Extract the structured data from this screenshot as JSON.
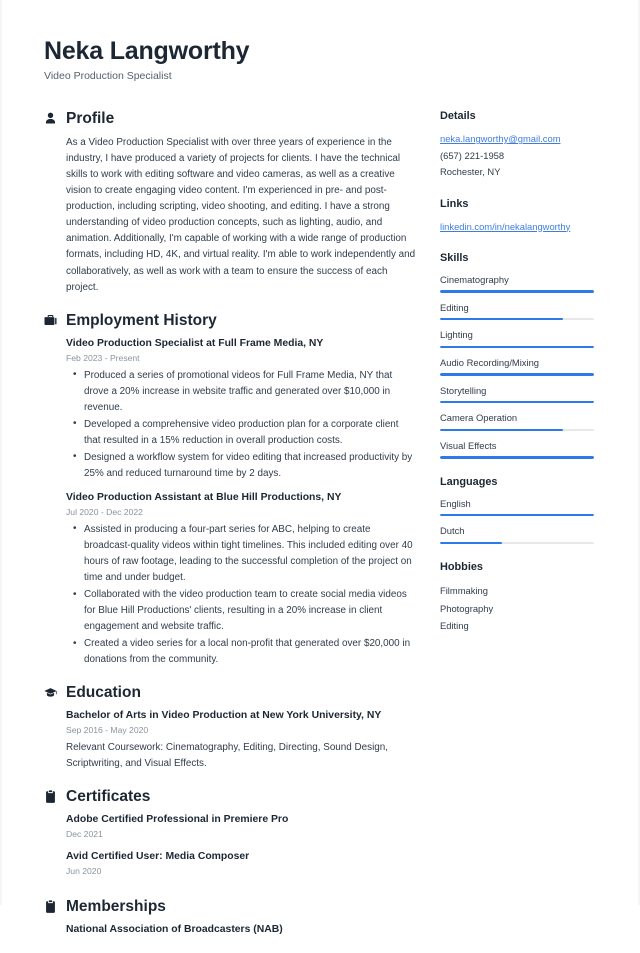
{
  "theme": {
    "accent": "#2f7aea",
    "link": "#3f7ce0",
    "heading": "#1c2733",
    "text": "#313c4b",
    "muted": "#8a939f",
    "track": "#e6e8ea",
    "background": "#ffffff"
  },
  "header": {
    "name": "Neka Langworthy",
    "title": "Video Production Specialist"
  },
  "sections": {
    "profile": {
      "icon": "person-icon",
      "title": "Profile",
      "text": "As a Video Production Specialist with over three years of experience in the industry, I have produced a variety of projects for clients. I have the technical skills to work with editing software and video cameras, as well as a creative vision to create engaging video content. I'm experienced in pre- and post-production, including scripting, video shooting, and editing. I have a strong understanding of video production concepts, such as lighting, audio, and animation. Additionally, I'm capable of working with a wide range of production formats, including HD, 4K, and virtual reality. I'm able to work independently and collaboratively, as well as work with a team to ensure the success of each project."
    },
    "employment": {
      "icon": "briefcase-icon",
      "title": "Employment History",
      "entries": [
        {
          "title": "Video Production Specialist at Full Frame Media, NY",
          "date": "Feb 2023 - Present",
          "bullets": [
            "Produced a series of promotional videos for Full Frame Media, NY that drove a 20% increase in website traffic and generated over $10,000 in revenue.",
            "Developed a comprehensive video production plan for a corporate client that resulted in a 15% reduction in overall production costs.",
            "Designed a workflow system for video editing that increased productivity by 25% and reduced turnaround time by 2 days."
          ]
        },
        {
          "title": "Video Production Assistant at Blue Hill Productions, NY",
          "date": "Jul 2020 - Dec 2022",
          "bullets": [
            "Assisted in producing a four-part series for ABC, helping to create broadcast-quality videos within tight timelines. This included editing over 40 hours of raw footage, leading to the successful completion of the project on time and under budget.",
            "Collaborated with the video production team to create social media videos for Blue Hill Productions' clients, resulting in a 20% increase in client engagement and website traffic.",
            "Created a video series for a local non-profit that generated over $20,000 in donations from the community."
          ]
        }
      ]
    },
    "education": {
      "icon": "graduation-cap-icon",
      "title": "Education",
      "entries": [
        {
          "title": "Bachelor of Arts in Video Production at New York University, NY",
          "date": "Sep 2016 - May 2020",
          "description": "Relevant Coursework: Cinematography, Editing, Directing, Sound Design, Scriptwriting, and Visual Effects."
        }
      ]
    },
    "certificates": {
      "icon": "clipboard-icon",
      "title": "Certificates",
      "entries": [
        {
          "title": "Adobe Certified Professional in Premiere Pro",
          "date": "Dec 2021"
        },
        {
          "title": "Avid Certified User: Media Composer",
          "date": "Jun 2020"
        }
      ]
    },
    "memberships": {
      "icon": "clipboard-icon",
      "title": "Memberships",
      "entries": [
        {
          "title": "National Association of Broadcasters (NAB)"
        }
      ]
    }
  },
  "sidebar": {
    "details": {
      "title": "Details",
      "email": "neka.langworthy@gmail.com",
      "phone": "(657) 221-1958",
      "location": "Rochester, NY"
    },
    "links": {
      "title": "Links",
      "items": [
        {
          "label": "linkedin.com/in/nekalangworthy"
        }
      ]
    },
    "skills": {
      "title": "Skills",
      "items": [
        {
          "label": "Cinematography",
          "level": 100
        },
        {
          "label": "Editing",
          "level": 80
        },
        {
          "label": "Lighting",
          "level": 100
        },
        {
          "label": "Audio Recording/Mixing",
          "level": 100
        },
        {
          "label": "Storytelling",
          "level": 100
        },
        {
          "label": "Camera Operation",
          "level": 80
        },
        {
          "label": "Visual Effects",
          "level": 100
        }
      ]
    },
    "languages": {
      "title": "Languages",
      "items": [
        {
          "label": "English",
          "level": 100
        },
        {
          "label": "Dutch",
          "level": 40
        }
      ]
    },
    "hobbies": {
      "title": "Hobbies",
      "items": [
        {
          "label": "Filmmaking"
        },
        {
          "label": "Photography"
        },
        {
          "label": "Editing"
        }
      ]
    }
  }
}
